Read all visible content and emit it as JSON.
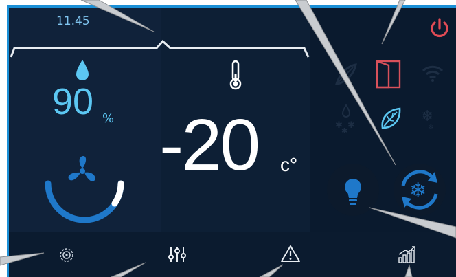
{
  "header": {
    "time": "11.45"
  },
  "humidity": {
    "value": "90",
    "unit": "%"
  },
  "temperature": {
    "value": "-20",
    "unit": "c°"
  },
  "status_icons": [
    "power-icon",
    "leaf-gesture-icon",
    "door-icon",
    "wifi-icon",
    "defrost-icon",
    "eco-leaf-icon",
    "snowflake-icon"
  ],
  "fan": {
    "level": 0.85
  },
  "colors": {
    "panel": "#0c1d32",
    "accent": "#1a8fd6",
    "power": "#e14b55",
    "door": "#d8515b",
    "humidity": "#5cc7f2",
    "fan_blue": "#1f78c9"
  },
  "bottom_bar": {
    "icons": [
      "settings-icon",
      "sliders-icon",
      "warning-icon",
      "stats-icon"
    ]
  }
}
